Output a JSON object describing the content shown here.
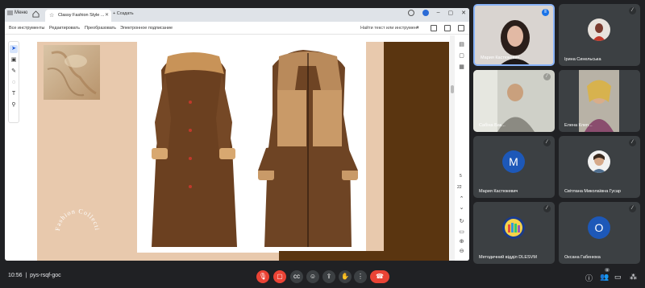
{
  "browser": {
    "menu_label": "Меню",
    "tab_title": "Classy Fashion Style ...",
    "new_tab_label": "Создать",
    "toolbar_links": [
      "Все инструменты",
      "Редактировать",
      "Преобразовать",
      "Электронное подписание"
    ],
    "search_placeholder": "Найти текст или инструмент",
    "page_number": "5",
    "page_total": "22"
  },
  "slide": {
    "watermark_text": "Fashion Collection"
  },
  "participants": [
    {
      "name": "Мария Кастюкевич",
      "avatar_type": "video",
      "active_speaker": true
    },
    {
      "name": "Ірина Синельська",
      "avatar_type": "photo"
    },
    {
      "name": "Сабіна Бак...",
      "avatar_type": "video"
    },
    {
      "name": "Елена Клеп...",
      "avatar_type": "video"
    },
    {
      "name": "Мария Кастюкевич",
      "avatar_type": "letter",
      "letter": "M"
    },
    {
      "name": "Світлана Миколаївна Гусар",
      "avatar_type": "photo"
    },
    {
      "name": "Методичний відділ DLESVM",
      "avatar_type": "logo"
    },
    {
      "name": "Оксана Габенюка",
      "avatar_type": "letter",
      "letter": "O"
    }
  ],
  "meeting": {
    "time": "10:56",
    "code": "pys-rsqf-goc",
    "participant_count": "9"
  },
  "colors": {
    "control_red": "#ea4335",
    "avatar_blue": "#1d58b8",
    "slide_tan": "#e8c9ad",
    "slide_brown": "#5a3510"
  },
  "icons": [
    "mic-off-icon",
    "camera-off-icon",
    "captions-icon",
    "emoji-icon",
    "present-icon",
    "raise-hand-icon",
    "more-icon",
    "end-call-icon",
    "info-icon",
    "people-icon",
    "chat-icon",
    "activities-icon"
  ]
}
